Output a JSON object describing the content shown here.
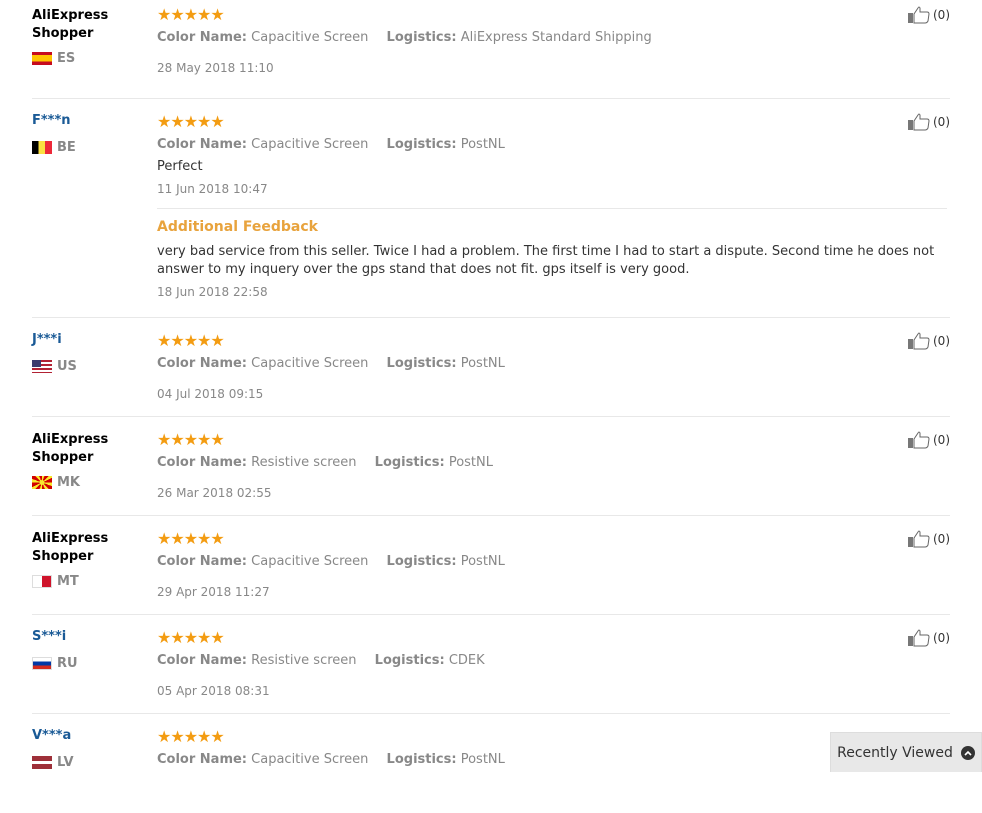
{
  "colors": {
    "star": "#f39c12",
    "masked_user": "#1a5a96",
    "additional_feedback": "#e8a33d"
  },
  "labels": {
    "color_name": "Color Name:",
    "logistics": "Logistics:",
    "additional_feedback": "Additional Feedback",
    "recently_viewed": "Recently Viewed"
  },
  "reviews": [
    {
      "user": "AliExpress Shopper",
      "country": "ES",
      "stars": "★★★★★",
      "color": "Capacitive Screen",
      "logistics": "AliExpress Standard Shipping",
      "text": "",
      "date": "28 May 2018 11:10",
      "helpful": "(0)"
    },
    {
      "user": "F***n",
      "country": "BE",
      "stars": "★★★★★",
      "color": "Capacitive Screen",
      "logistics": "PostNL",
      "text": "Perfect",
      "date": "11 Jun 2018 10:47",
      "helpful": "(0)",
      "additional": {
        "text": "very bad service from this seller. Twice I had a problem. The first time I had to start a dispute. Second time he does not answer to my inquery over the gps stand that does not fit. gps itself is very good.",
        "date": "18 Jun 2018 22:58"
      }
    },
    {
      "user": "J***i",
      "country": "US",
      "stars": "★★★★★",
      "color": "Capacitive Screen",
      "logistics": "PostNL",
      "text": "",
      "date": "04 Jul 2018 09:15",
      "helpful": "(0)"
    },
    {
      "user": "AliExpress Shopper",
      "country": "MK",
      "stars": "★★★★★",
      "color": "Resistive screen",
      "logistics": "PostNL",
      "text": "",
      "date": "26 Mar 2018 02:55",
      "helpful": "(0)"
    },
    {
      "user": "AliExpress Shopper",
      "country": "MT",
      "stars": "★★★★★",
      "color": "Capacitive Screen",
      "logistics": "PostNL",
      "text": "",
      "date": "29 Apr 2018 11:27",
      "helpful": "(0)"
    },
    {
      "user": "S***i",
      "country": "RU",
      "stars": "★★★★★",
      "color": "Resistive screen",
      "logistics": "CDEK",
      "text": "",
      "date": "05 Apr 2018 08:31",
      "helpful": "(0)"
    },
    {
      "user": "V***a",
      "country": "LV",
      "stars": "★★★★★",
      "color": "Capacitive Screen",
      "logistics": "PostNL",
      "text": "",
      "date": "",
      "helpful": ""
    }
  ]
}
